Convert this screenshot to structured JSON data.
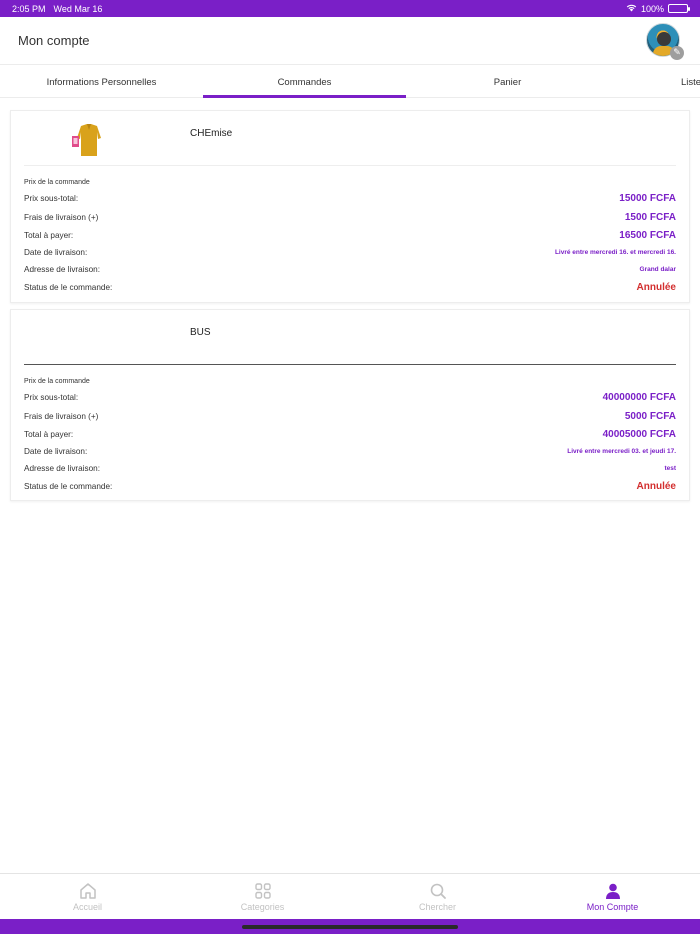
{
  "status_bar": {
    "time": "2:05 PM",
    "date": "Wed Mar 16",
    "battery": "100%"
  },
  "header": {
    "title": "Mon compte"
  },
  "tabs": [
    {
      "label": "Informations Personnelles"
    },
    {
      "label": "Commandes"
    },
    {
      "label": "Panier"
    },
    {
      "label": "Liste"
    }
  ],
  "active_tab": "Commandes",
  "orders": [
    {
      "product_name": "CHEmise",
      "section_label": "Prix de la commande",
      "rows": [
        {
          "label": "Prix sous-total:",
          "value": "15000 FCFA"
        },
        {
          "label": "Frais de livraison (+)",
          "value": "1500 FCFA"
        },
        {
          "label": "Total à payer:",
          "value": "16500 FCFA"
        },
        {
          "label": "Date de livraison:",
          "value": "Livré entre mercredi 16. et mercredi 16."
        },
        {
          "label": "Adresse de livraison:",
          "value": "Grand dalar"
        },
        {
          "label": "Status de le commande:",
          "value": "Annulée"
        }
      ]
    },
    {
      "product_name": "BUS",
      "section_label": "Prix de la commande",
      "rows": [
        {
          "label": "Prix sous-total:",
          "value": "40000000 FCFA"
        },
        {
          "label": "Frais de livraison (+)",
          "value": "5000 FCFA"
        },
        {
          "label": "Total à payer:",
          "value": "40005000 FCFA"
        },
        {
          "label": "Date de livraison:",
          "value": "Livré entre mercredi 03. et jeudi 17."
        },
        {
          "label": "Adresse de livraison:",
          "value": "test"
        },
        {
          "label": "Status de le commande:",
          "value": "Annulée"
        }
      ]
    }
  ],
  "bottom_nav": [
    {
      "label": "Accueil",
      "icon": "home-icon"
    },
    {
      "label": "Categories",
      "icon": "grid-icon"
    },
    {
      "label": "Chercher",
      "icon": "search-icon"
    },
    {
      "label": "Mon Compte",
      "icon": "user-icon"
    }
  ],
  "colors": {
    "accent": "#7a1fc7",
    "status_cancelled": "#d32f2f",
    "nav_inactive": "#c2c2c2"
  }
}
